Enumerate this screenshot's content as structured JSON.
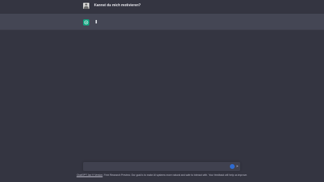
{
  "conversation": {
    "user_message": "Kannst du mich motivieren?",
    "assistant_message": "",
    "colors": {
      "background": "#343541",
      "assistant_row": "#444654",
      "bot_avatar": "#10a37f",
      "text": "#ececf1"
    }
  },
  "icons": {
    "user_avatar": "user-avatar-icon",
    "bot_avatar": "openai-logo-icon",
    "assist": "extension-badge-icon",
    "send": "send-arrow-icon"
  },
  "composer": {
    "placeholder": "",
    "value": ""
  },
  "footer": {
    "link_text": "ChatGPT Jan 9 Version",
    "text": ". Free Research Preview. Our goal is to make AI systems more natural and safe to interact with. Your feedback will help us improve."
  }
}
